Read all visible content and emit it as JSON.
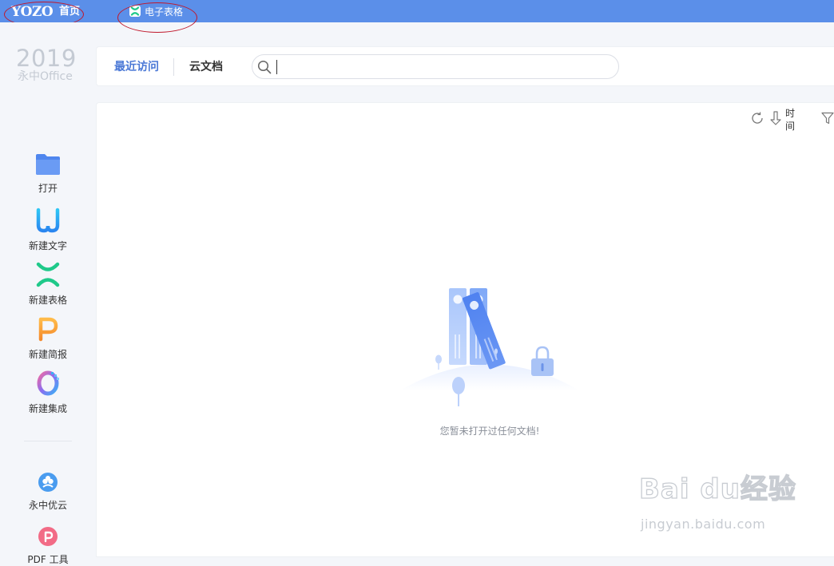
{
  "titlebar": {
    "logo": "YOZO",
    "home_tab": "首页",
    "doc_tab": "电子表格",
    "doc_tab_icon": "spreadsheet-x-icon",
    "bg_color": "#5b8fe9"
  },
  "sidebar": {
    "brand_year": "2019",
    "brand_name": "永中Office",
    "items": [
      {
        "label": "打开",
        "icon": "folder-icon"
      },
      {
        "label": "新建文字",
        "icon": "word-w-icon"
      },
      {
        "label": "新建表格",
        "icon": "spreadsheet-x-icon"
      },
      {
        "label": "新建简报",
        "icon": "presentation-p-icon"
      },
      {
        "label": "新建集成",
        "icon": "integration-o-icon"
      }
    ],
    "bottom_items": [
      {
        "label": "永中优云",
        "icon": "cloud-icon"
      },
      {
        "label": "PDF 工具",
        "icon": "pdf-icon"
      }
    ]
  },
  "tabs": {
    "recent": "最近访问",
    "cloud": "云文档"
  },
  "search": {
    "placeholder": "",
    "value": ""
  },
  "toolbar": {
    "sort_label": "时间"
  },
  "empty_state": {
    "message": "您暂未打开过任何文档!"
  },
  "watermark": {
    "brand": "Bai du经验",
    "url": "jingyan.baidu.com"
  },
  "colors": {
    "accent": "#4a78d6",
    "word": "#2aa6f0",
    "sheet": "#1fc98a",
    "slide": "#f7a53b"
  }
}
